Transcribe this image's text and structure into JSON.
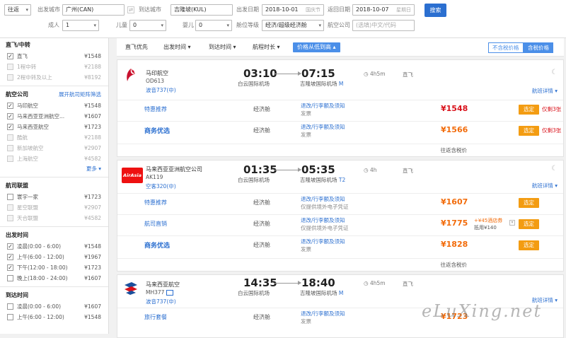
{
  "search": {
    "trip_type": "往返",
    "from_label": "出发城市",
    "from_value": "广州(CAN)",
    "swap_label": "⇄",
    "to_label": "到达城市",
    "to_value": "吉隆坡(KUL)",
    "depart_label": "出发日期",
    "depart_value": "2018-10-01",
    "depart_hint": "国庆节",
    "return_label": "返回日期",
    "return_value": "2018-10-07",
    "return_hint": "星期日",
    "search_button": "搜索",
    "adult_label": "成人",
    "adult_value": "1",
    "child_label": "儿童",
    "child_value": "0",
    "infant_label": "婴儿",
    "infant_value": "0",
    "cabin_label": "舱位等级",
    "cabin_value": "经济/超级经济舱",
    "airline_label": "航空公司",
    "airline_placeholder": "(选填)中文/代码"
  },
  "sidebar": {
    "transfer": {
      "title": "直飞/中转",
      "items": [
        {
          "label": "直飞",
          "price": "¥1548",
          "checked": true,
          "disabled": false
        },
        {
          "label": "1程中转",
          "price": "¥2188",
          "checked": false,
          "disabled": true
        },
        {
          "label": "2程中转及以上",
          "price": "¥8192",
          "checked": false,
          "disabled": true
        }
      ]
    },
    "airlines": {
      "title": "航空公司",
      "link": "展开航司矩阵筛选",
      "items": [
        {
          "label": "马印航空",
          "price": "¥1548",
          "checked": true,
          "disabled": false
        },
        {
          "label": "马来西亚亚洲航空...",
          "price": "¥1607",
          "checked": true,
          "disabled": false
        },
        {
          "label": "马来西亚航空",
          "price": "¥1723",
          "checked": true,
          "disabled": false
        },
        {
          "label": "酷航",
          "price": "¥2188",
          "checked": false,
          "disabled": true
        },
        {
          "label": "新加坡航空",
          "price": "¥2907",
          "checked": false,
          "disabled": true
        },
        {
          "label": "上海航空",
          "price": "¥4582",
          "checked": false,
          "disabled": true
        }
      ],
      "more": "更多"
    },
    "alliance": {
      "title": "航司联盟",
      "items": [
        {
          "label": "寰宇一家",
          "price": "¥1723",
          "checked": false,
          "disabled": false
        },
        {
          "label": "星空联盟",
          "price": "¥2907",
          "checked": false,
          "disabled": true
        },
        {
          "label": "天合联盟",
          "price": "¥4582",
          "checked": false,
          "disabled": true
        }
      ]
    },
    "depart_time": {
      "title": "出发时间",
      "items": [
        {
          "label": "凌晨(0:00 - 6:00)",
          "price": "¥1548",
          "checked": true,
          "disabled": false
        },
        {
          "label": "上午(6:00 - 12:00)",
          "price": "¥1967",
          "checked": true,
          "disabled": false
        },
        {
          "label": "下午(12:00 - 18:00)",
          "price": "¥1723",
          "checked": true,
          "disabled": false
        },
        {
          "label": "晚上(18:00 - 24:00)",
          "price": "¥1607",
          "checked": false,
          "disabled": false
        }
      ]
    },
    "arrive_time": {
      "title": "到达时间",
      "items": [
        {
          "label": "凌晨(0:00 - 6:00)",
          "price": "¥1607",
          "checked": false,
          "disabled": false
        },
        {
          "label": "上午(6:00 - 12:00)",
          "price": "¥1548",
          "checked": false,
          "disabled": false
        }
      ]
    }
  },
  "sortbar": {
    "direct_first": "直飞优先",
    "depart_time": "出发时间",
    "arrive_time": "到达时间",
    "duration": "航程时长",
    "price_low": "价格从低到高",
    "no_tax": "不含税价格",
    "with_tax": "含税价格"
  },
  "flights": [
    {
      "airline": "马印航空",
      "code": "OD613",
      "aircraft": "波音737(中)",
      "dep_time": "03:10",
      "dep_airport": "白云国际机场",
      "arr_time": "07:15",
      "arr_airport": "吉隆坡国际机场",
      "arr_terminal": "M",
      "duration": "4h5m",
      "direct": "直飞",
      "detail": "航班详情",
      "roundtrip": "往返含税价",
      "rows": [
        {
          "label": "特惠推荐",
          "cabin": "经济舱",
          "rule": "退改/行李额及须知",
          "sub": "发票",
          "price": "¥1548",
          "left": "仅剩3张",
          "pick": "选定"
        },
        {
          "label": "商务优选",
          "cabin": "经济舱",
          "rule": "退改/行李额及须知",
          "sub": "发票",
          "price": "¥1566",
          "left": "仅剩3张",
          "pick": "选定"
        }
      ]
    },
    {
      "airline": "马来西亚亚洲航空公司",
      "code": "AK119",
      "aircraft": "空客320(中)",
      "logo_text": "AirAsia",
      "dep_time": "01:35",
      "dep_airport": "白云国际机场",
      "arr_time": "05:35",
      "arr_airport": "吉隆坡国际机场",
      "arr_terminal": "T2",
      "duration": "4h",
      "direct": "直飞",
      "detail": "航班详情",
      "roundtrip": "往返含税价",
      "rows": [
        {
          "label": "特惠推荐",
          "cabin": "经济舱",
          "rule": "退改/行李额及须知",
          "sub": "仅提供境外电子凭证",
          "price": "¥1607",
          "pick": "选定"
        },
        {
          "label": "航司直销",
          "cabin": "经济舱",
          "rule": "退改/行李额及须知",
          "sub": "仅提供境外电子凭证",
          "price": "¥1775",
          "hotel_a": "+¥45酒店券",
          "hotel_b": "抵用¥140",
          "pick": "选定"
        },
        {
          "label": "商务优选",
          "cabin": "经济舱",
          "rule": "退改/行李额及须知",
          "sub": "发票",
          "price": "¥1828",
          "pick": "选定"
        }
      ]
    },
    {
      "airline": "马来西亚航空",
      "code": "MH377",
      "aircraft": "波音737(中)",
      "dep_time": "14:35",
      "dep_airport": "白云国际机场",
      "arr_time": "18:40",
      "arr_airport": "吉隆坡国际机场",
      "arr_terminal": "M",
      "duration": "4h5m",
      "direct": "直飞",
      "detail": "航班详情",
      "rows": [
        {
          "label": "旅行套餐",
          "cabin": "经济舱",
          "rule": "退改/行李额及须知",
          "sub": "发票",
          "price": "¥1723"
        }
      ]
    }
  ],
  "watermark": "eLuXing.net"
}
